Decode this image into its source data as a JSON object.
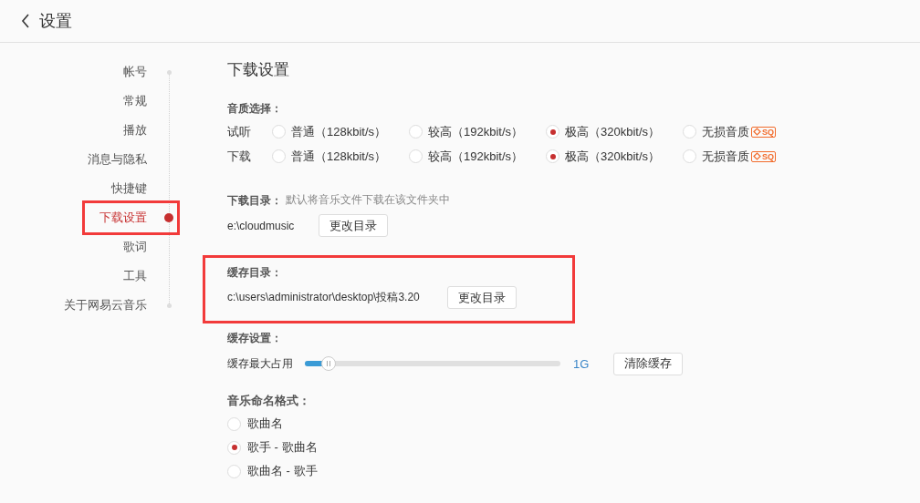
{
  "header": {
    "title": "设置"
  },
  "sidebar": {
    "items": [
      {
        "label": "帐号",
        "selected": false,
        "highlighted": false
      },
      {
        "label": "常规",
        "selected": false,
        "highlighted": false
      },
      {
        "label": "播放",
        "selected": false,
        "highlighted": false
      },
      {
        "label": "消息与隐私",
        "selected": false,
        "highlighted": false
      },
      {
        "label": "快捷键",
        "selected": false,
        "highlighted": false
      },
      {
        "label": "下载设置",
        "selected": true,
        "highlighted": true
      },
      {
        "label": "歌词",
        "selected": false,
        "highlighted": false
      },
      {
        "label": "工具",
        "selected": false,
        "highlighted": false
      },
      {
        "label": "关于网易云音乐",
        "selected": false,
        "highlighted": false
      }
    ]
  },
  "page_title": "下载设置",
  "quality": {
    "label": "音质选择：",
    "rows": [
      {
        "label": "试听",
        "options": [
          {
            "label": "普通（128kbit/s）",
            "selected": false
          },
          {
            "label": "较高（192kbit/s）",
            "selected": false
          },
          {
            "label": "极高（320kbit/s）",
            "selected": true
          },
          {
            "label": "无损音质",
            "selected": false,
            "badge": "SQ"
          }
        ]
      },
      {
        "label": "下载",
        "options": [
          {
            "label": "普通（128kbit/s）",
            "selected": false
          },
          {
            "label": "较高（192kbit/s）",
            "selected": false
          },
          {
            "label": "极高（320kbit/s）",
            "selected": true
          },
          {
            "label": "无损音质",
            "selected": false,
            "badge": "SQ"
          }
        ]
      }
    ]
  },
  "download_dir": {
    "label": "下载目录：",
    "hint": "默认将音乐文件下载在该文件夹中",
    "path": "e:\\cloudmusic",
    "button": "更改目录"
  },
  "cache_dir": {
    "label": "缓存目录：",
    "path": "c:\\users\\administrator\\desktop\\投稿3.20",
    "button": "更改目录",
    "highlighted": true
  },
  "cache_settings": {
    "label": "缓存设置：",
    "slider_label": "缓存最大占用",
    "level": 0.07,
    "reading": "1G",
    "button": "清除缓存"
  },
  "naming": {
    "label": "音乐命名格式：",
    "options": [
      {
        "label": "歌曲名",
        "selected": false
      },
      {
        "label": "歌手 - 歌曲名",
        "selected": true
      },
      {
        "label": "歌曲名 - 歌手",
        "selected": false
      }
    ]
  }
}
